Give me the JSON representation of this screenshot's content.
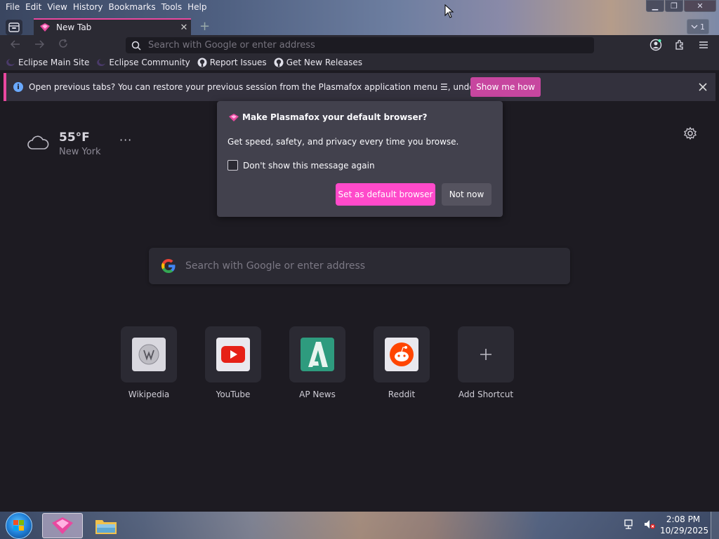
{
  "menu": {
    "items": [
      "File",
      "Edit",
      "View",
      "History",
      "Bookmarks",
      "Tools",
      "Help"
    ]
  },
  "window": {
    "minimize_glyph": "▁",
    "maximize_glyph": "❐",
    "close_glyph": "✕"
  },
  "tabs": {
    "active_title": "New Tab",
    "close_glyph": "✕",
    "new_tab_glyph": "+",
    "list_count": "1"
  },
  "urlbar": {
    "placeholder": "Search with Google or enter address"
  },
  "bookmarks": [
    {
      "label": "Eclipse Main Site",
      "icon": "eclipse-icon"
    },
    {
      "label": "Eclipse Community",
      "icon": "eclipse-icon"
    },
    {
      "label": "Report Issues",
      "icon": "github-icon"
    },
    {
      "label": "Get New Releases",
      "icon": "github-icon"
    }
  ],
  "notification": {
    "message": "Open previous tabs? You can restore your previous session from the Plasmafox application menu ☰, under History.",
    "button": "Show me how",
    "accent": "#e9489f"
  },
  "weather": {
    "temperature": "55°F",
    "city": "New York",
    "more": "···"
  },
  "default_prompt": {
    "title": "Make Plasmafox your default browser?",
    "description": "Get speed, safety, and privacy every time you browse.",
    "checkbox_label": "Don't show this message again",
    "checkbox_checked": false,
    "primary_button": "Set as default browser",
    "secondary_button": "Not now",
    "primary_color": "#ff4aca"
  },
  "search": {
    "placeholder": "Search with Google or enter address"
  },
  "shortcuts": [
    {
      "label": "Wikipedia",
      "icon": "wikipedia-icon"
    },
    {
      "label": "YouTube",
      "icon": "youtube-icon"
    },
    {
      "label": "AP News",
      "icon": "apnews-icon"
    },
    {
      "label": "Reddit",
      "icon": "reddit-icon"
    },
    {
      "label": "Add Shortcut",
      "icon": "plus-icon"
    }
  ],
  "taskbar": {
    "time": "2:08 PM",
    "date": "10/29/2025"
  }
}
